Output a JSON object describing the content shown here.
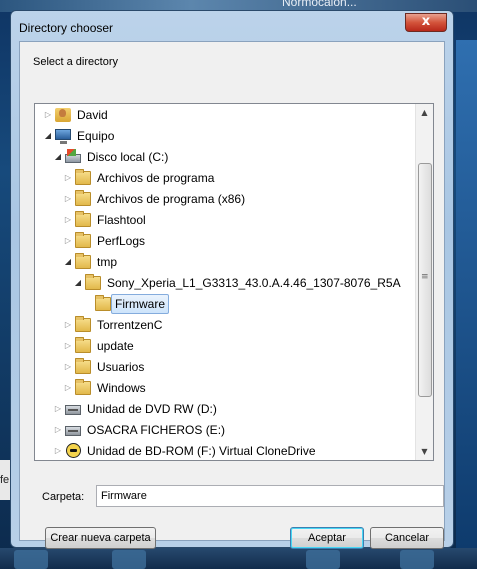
{
  "background": {
    "top_text": "Normocalon...",
    "left_text": "fe"
  },
  "window": {
    "title": "Directory chooser",
    "close_label": "x"
  },
  "prompt": "Select a directory",
  "tree": {
    "items": [
      {
        "label": "David",
        "icon": "user-folder-icon",
        "expander": "collapsed"
      },
      {
        "label": "Equipo",
        "icon": "computer-icon",
        "expander": "expanded"
      },
      {
        "label": "Disco local (C:)",
        "icon": "windows-disk-icon",
        "expander": "expanded"
      },
      {
        "label": "Archivos de programa",
        "icon": "folder-icon",
        "expander": "collapsed"
      },
      {
        "label": "Archivos de programa (x86)",
        "icon": "folder-icon",
        "expander": "collapsed"
      },
      {
        "label": "Flashtool",
        "icon": "folder-icon",
        "expander": "collapsed"
      },
      {
        "label": "PerfLogs",
        "icon": "folder-icon",
        "expander": "collapsed"
      },
      {
        "label": "tmp",
        "icon": "folder-icon",
        "expander": "expanded"
      },
      {
        "label": "Sony_Xperia_L1_G3313_43.0.A.4.46_1307-8076_R5A",
        "icon": "folder-icon",
        "expander": "expanded"
      },
      {
        "label": "Firmware",
        "icon": "folder-icon",
        "expander": "none",
        "selected": true
      },
      {
        "label": "TorrentzenC",
        "icon": "folder-icon",
        "expander": "collapsed"
      },
      {
        "label": "update",
        "icon": "folder-icon",
        "expander": "collapsed"
      },
      {
        "label": "Usuarios",
        "icon": "folder-icon",
        "expander": "collapsed"
      },
      {
        "label": "Windows",
        "icon": "folder-icon",
        "expander": "collapsed"
      },
      {
        "label": "Unidad de DVD RW (D:)",
        "icon": "dvd-drive-icon",
        "expander": "collapsed"
      },
      {
        "label": "OSACRA FICHEROS (E:)",
        "icon": "hard-drive-icon",
        "expander": "collapsed"
      },
      {
        "label": "Unidad de BD-ROM (F:) Virtual CloneDrive",
        "icon": "clonedrive-icon",
        "expander": "collapsed"
      }
    ]
  },
  "folder_field": {
    "label": "Carpeta:",
    "value": "Firmware"
  },
  "buttons": {
    "new_folder": "Crear nueva carpeta",
    "accept": "Aceptar",
    "cancel": "Cancelar"
  },
  "colors": {
    "selection_bg": "#cde4fb",
    "selection_border": "#84acdd",
    "title_bg": "#bcd3ea",
    "close_red": "#d3543b"
  }
}
